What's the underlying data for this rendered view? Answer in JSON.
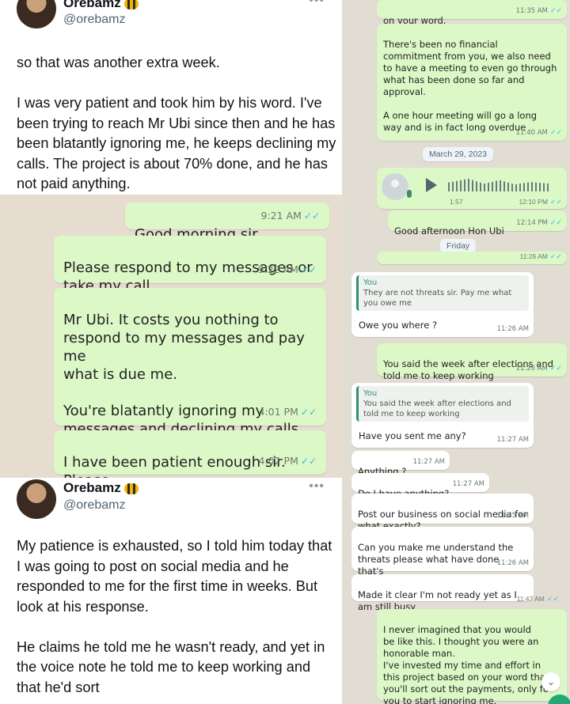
{
  "tweet_top": {
    "name": "Orebamz",
    "handle": "@orebamz",
    "more": "•••",
    "text": "so that was another extra week.\n\nI was very patient and took him by his word. I've been trying to reach Mr Ubi since then and he has been blatantly ignoring me, he keeps declining my calls. The project is about 70% done, and he has not paid anything."
  },
  "tweet_bottom": {
    "name": "Orebamz",
    "handle": "@orebamz",
    "more": "•••",
    "text": "My patience is exhausted, so I told him today that I was going to post on social media and he responded to me for the first time in weeks. But look at his response.\n\nHe claims he told me he wasn't ready, and yet in the voice note he told me to keep working and that he'd sort"
  },
  "chat_left": {
    "tick": "✓✓",
    "messages": [
      {
        "text": "Good morning sir",
        "time": "9:21 AM"
      },
      {
        "text": "Please respond to my messages or\ntake my call",
        "time": "9:22 AM"
      },
      {
        "text": "Mr Ubi. It costs you nothing to\nrespond to my messages and pay me\nwhat is due me.\n\nYou're blatantly ignoring my\nmessages and declining my calls.",
        "time": "4:01 PM"
      },
      {
        "text": "I have been patient enough sir. Please\ndo the right thing",
        "time": "4:02 PM"
      }
    ]
  },
  "chat_right": {
    "tick": "✓✓",
    "m1": {
      "text": "on your word.",
      "time": "11:35 AM"
    },
    "m2": {
      "text": "There's been no financial\ncommitment from you, we also need\nto have a meeting to even go through\nwhat has been done so far and\napproval.\n\nA one hour meeting will go a long\nway and is in fact long overdue",
      "time": "11:40 AM"
    },
    "date1": "March 29, 2023",
    "voice": {
      "duration": "1:57",
      "time": "12:10 PM"
    },
    "m3": {
      "text": "Good afternoon Hon Ubi",
      "time": "12:14 PM"
    },
    "date2": "Friday",
    "m4": {
      "time": "11:26 AM"
    },
    "m5": {
      "quote_name": "You",
      "quote_text": "They are not threats sir. Pay me what you owe me",
      "text": "Owe you where ?",
      "time": "11:26 AM"
    },
    "m6": {
      "text": "You said the week after elections and\ntold me to keep working",
      "time": "11:26 AM"
    },
    "m7": {
      "quote_name": "You",
      "quote_text": "You said the week after elections and told me to keep working",
      "text": "Have you sent me any?",
      "time": "11:27 AM"
    },
    "m8": {
      "text": "Anything ?",
      "time": "11:27 AM"
    },
    "m9": {
      "text": "Do I have anything?",
      "time": "11:27 AM"
    },
    "m10": {
      "text": "Post our business on social media for\nwhat exactly?",
      "time": "11:25 AM"
    },
    "m11": {
      "text": "Can you make me understand the\nthreats please what have done that's\nbrining the threats ?",
      "time": "11:26 AM"
    },
    "m12": {
      "text": "Made it clear I'm not ready yet as I\nam still busy",
      "time": "11:47 AM"
    },
    "m13": {
      "text": "I never imagined that you would\nbe like this. I thought you were an\nhonorable man.\nI've invested my time and effort in\nthis project based on your word that\nyou'll sort out the payments, only fo\nyou to start ignoring me."
    }
  }
}
